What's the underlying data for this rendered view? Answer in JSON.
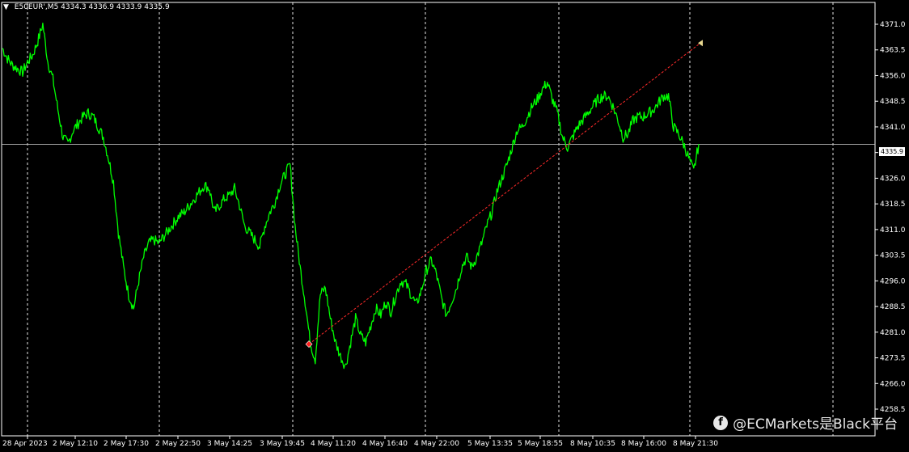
{
  "header": {
    "dropdown_icon": "triangle-down-icon",
    "symbol": "E50EUR',M5",
    "ohlc": "4334.3 4336.9 4333.9 4335.9"
  },
  "watermark": {
    "icon": "facebook-icon",
    "icon_glyph": "f",
    "text": "@ECMarkets是Black平台"
  },
  "current_price": "4335.9",
  "colors": {
    "background": "#000000",
    "price_line": "#00ff00",
    "trend_line": "#ff2a2a",
    "grid": "#ffffff",
    "start_marker": "#ff2020",
    "end_marker": "#e8d890"
  },
  "chart_data": {
    "type": "line",
    "ylim": [
      4256.0,
      4375.0
    ],
    "y_ticks": [
      "4371.0",
      "4363.5",
      "4356.0",
      "4348.5",
      "4341.0",
      "4333.5",
      "4326.0",
      "4318.5",
      "4311.0",
      "4303.5",
      "4296.0",
      "4288.5",
      "4281.0",
      "4273.5",
      "4266.0",
      "4258.5"
    ],
    "x_ticks": [
      "28 Apr 2023",
      "2 May 12:10",
      "2 May 17:30",
      "2 May 22:50",
      "3 May 14:25",
      "3 May 19:45",
      "4 May 11:20",
      "4 May 16:40",
      "4 May 22:00",
      "5 May 13:35",
      "5 May 18:55",
      "8 May 10:35",
      "8 May 16:00",
      "8 May 21:30"
    ],
    "series": [
      {
        "values": [
          4364,
          4361,
          4359,
          4358,
          4357,
          4360,
          4362,
          4366,
          4371,
          4360,
          4355,
          4346,
          4338,
          4336,
          4340,
          4342,
          4344,
          4345,
          4344,
          4341,
          4338,
          4332,
          4325,
          4310,
          4300,
          4292,
          4288,
          4296,
          4303,
          4307,
          4308,
          4307,
          4309,
          4311,
          4313,
          4315,
          4316,
          4318,
          4320,
          4322,
          4324,
          4323,
          4316,
          4318,
          4320,
          4321,
          4323,
          4318,
          4312,
          4310,
          4308,
          4306,
          4312,
          4316,
          4319,
          4324,
          4327,
          4330,
          4312,
          4300,
          4290,
          4278,
          4273,
          4292,
          4294,
          4285,
          4278,
          4274,
          4271,
          4278,
          4285,
          4280,
          4278,
          4283,
          4288,
          4286,
          4290,
          4287,
          4292,
          4296,
          4295,
          4292,
          4289,
          4293,
          4299,
          4302,
          4298,
          4291,
          4286,
          4290,
          4294,
          4300,
          4303,
          4300,
          4303,
          4307,
          4312,
          4316,
          4322,
          4326,
          4330,
          4335,
          4340,
          4341,
          4344,
          4347,
          4349,
          4352,
          4354,
          4349,
          4345,
          4338,
          4335,
          4338,
          4341,
          4343,
          4345,
          4347,
          4349,
          4350,
          4350,
          4347,
          4343,
          4338,
          4339,
          4343,
          4344,
          4344,
          4345,
          4346,
          4348,
          4350,
          4350,
          4341,
          4339,
          4336,
          4332,
          4328,
          4336
        ]
      }
    ],
    "trend_line": {
      "from": [
        4277.5,
        "4 May 11:20"
      ],
      "to": [
        4365.5,
        "8 May 21:30"
      ]
    }
  }
}
